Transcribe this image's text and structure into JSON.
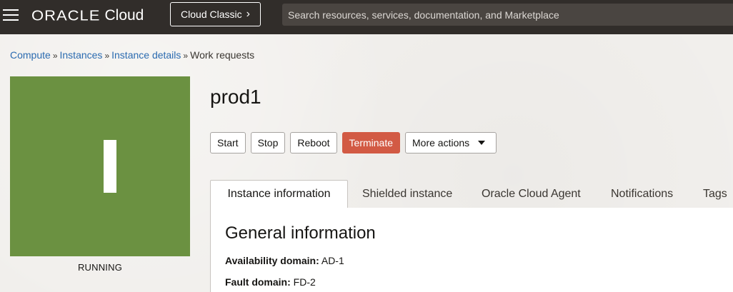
{
  "topbar": {
    "logo_oracle": "ORACLE",
    "logo_cloud": "Cloud",
    "classic_label": "Cloud Classic",
    "classic_chevron": "›",
    "search_placeholder": "Search resources, services, documentation, and Marketplace"
  },
  "breadcrumb": [
    {
      "label": "Compute",
      "link": true
    },
    {
      "label": "Instances",
      "link": true
    },
    {
      "label": "Instance details",
      "link": true
    },
    {
      "label": "Work requests",
      "link": false
    }
  ],
  "breadcrumb_separator": "»",
  "instance": {
    "name": "prod1",
    "icon_letter": "I",
    "status": "RUNNING",
    "tile_color": "#6b9141"
  },
  "actions": {
    "start": "Start",
    "stop": "Stop",
    "reboot": "Reboot",
    "terminate": "Terminate",
    "more": "More actions"
  },
  "tabs": [
    {
      "label": "Instance information",
      "active": true
    },
    {
      "label": "Shielded instance",
      "active": false
    },
    {
      "label": "Oracle Cloud Agent",
      "active": false
    },
    {
      "label": "Notifications",
      "active": false
    },
    {
      "label": "Tags",
      "active": false
    }
  ],
  "general": {
    "title": "General information",
    "availability_domain_label": "Availability domain:",
    "availability_domain_value": "AD-1",
    "fault_domain_label": "Fault domain:",
    "fault_domain_value": "FD-2"
  },
  "colors": {
    "topbar": "#312d2a",
    "link": "#2b6bb0",
    "terminate": "#d25a44",
    "running_tile": "#6b9141"
  }
}
